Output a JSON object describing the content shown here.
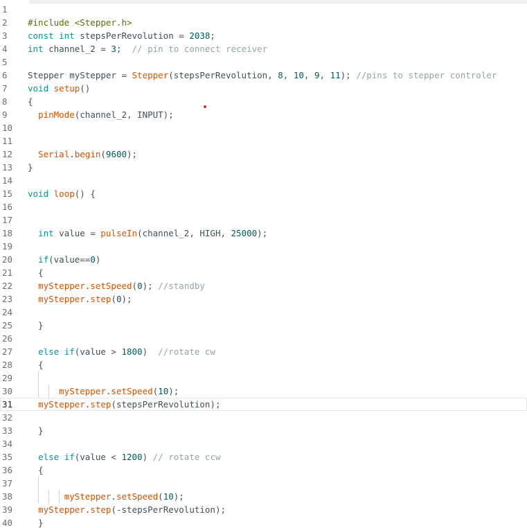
{
  "editor": {
    "current_line": 31,
    "lines": [
      {
        "n": "1",
        "tokens": []
      },
      {
        "n": "2",
        "tokens": [
          [
            "pp",
            "#include <Stepper.h>"
          ]
        ]
      },
      {
        "n": "3",
        "tokens": [
          [
            "kw",
            "const int"
          ],
          [
            "tx",
            " stepsPerRevolution = "
          ],
          [
            "num",
            "2038"
          ],
          [
            "tx",
            ";"
          ]
        ]
      },
      {
        "n": "4",
        "tokens": [
          [
            "kw",
            "int"
          ],
          [
            "tx",
            " channel_2 = "
          ],
          [
            "num",
            "3"
          ],
          [
            "tx",
            ";  "
          ],
          [
            "cm",
            "// pin to connect receiver"
          ]
        ]
      },
      {
        "n": "5",
        "tokens": []
      },
      {
        "n": "6",
        "tokens": [
          [
            "tx",
            "Stepper myStepper = "
          ],
          [
            "fn",
            "Stepper"
          ],
          [
            "tx",
            "(stepsPerRevolution, "
          ],
          [
            "num",
            "8"
          ],
          [
            "tx",
            ", "
          ],
          [
            "num",
            "10"
          ],
          [
            "tx",
            ", "
          ],
          [
            "num",
            "9"
          ],
          [
            "tx",
            ", "
          ],
          [
            "num",
            "11"
          ],
          [
            "tx",
            "); "
          ],
          [
            "cm",
            "//pins to stepper controler"
          ]
        ]
      },
      {
        "n": "7",
        "tokens": [
          [
            "kw",
            "void"
          ],
          [
            "tx",
            " "
          ],
          [
            "fn",
            "setup"
          ],
          [
            "tx",
            "()"
          ]
        ]
      },
      {
        "n": "8",
        "tokens": [
          [
            "tx",
            "{"
          ]
        ]
      },
      {
        "n": "9",
        "tokens": [
          [
            "tx",
            "  "
          ],
          [
            "fn",
            "pinMode"
          ],
          [
            "tx",
            "(channel_2, INPUT);"
          ]
        ]
      },
      {
        "n": "10",
        "tokens": []
      },
      {
        "n": "11",
        "tokens": []
      },
      {
        "n": "12",
        "tokens": [
          [
            "tx",
            "  "
          ],
          [
            "fn",
            "Serial"
          ],
          [
            "tx",
            "."
          ],
          [
            "fn",
            "begin"
          ],
          [
            "tx",
            "("
          ],
          [
            "num",
            "9600"
          ],
          [
            "tx",
            ");"
          ]
        ]
      },
      {
        "n": "13",
        "tokens": [
          [
            "tx",
            "}"
          ]
        ]
      },
      {
        "n": "14",
        "tokens": []
      },
      {
        "n": "15",
        "tokens": [
          [
            "kw",
            "void"
          ],
          [
            "tx",
            " "
          ],
          [
            "fn",
            "loop"
          ],
          [
            "tx",
            "() {"
          ]
        ]
      },
      {
        "n": "16",
        "tokens": []
      },
      {
        "n": "17",
        "tokens": []
      },
      {
        "n": "18",
        "tokens": [
          [
            "tx",
            "  "
          ],
          [
            "kw",
            "int"
          ],
          [
            "tx",
            " value = "
          ],
          [
            "fn",
            "pulseIn"
          ],
          [
            "tx",
            "(channel_2, HIGH, "
          ],
          [
            "num",
            "25000"
          ],
          [
            "tx",
            ");"
          ]
        ]
      },
      {
        "n": "19",
        "tokens": []
      },
      {
        "n": "20",
        "tokens": [
          [
            "tx",
            "  "
          ],
          [
            "kw",
            "if"
          ],
          [
            "tx",
            "(value=="
          ],
          [
            "num",
            "0"
          ],
          [
            "tx",
            ")"
          ]
        ]
      },
      {
        "n": "21",
        "tokens": [
          [
            "tx",
            "  {"
          ]
        ]
      },
      {
        "n": "22",
        "tokens": [
          [
            "tx",
            "  "
          ],
          [
            "fn",
            "myStepper"
          ],
          [
            "tx",
            "."
          ],
          [
            "fn",
            "setSpeed"
          ],
          [
            "tx",
            "("
          ],
          [
            "num",
            "0"
          ],
          [
            "tx",
            "); "
          ],
          [
            "cm",
            "//standby"
          ]
        ]
      },
      {
        "n": "23",
        "tokens": [
          [
            "tx",
            "  "
          ],
          [
            "fn",
            "myStepper"
          ],
          [
            "tx",
            "."
          ],
          [
            "fn",
            "step"
          ],
          [
            "tx",
            "("
          ],
          [
            "num",
            "0"
          ],
          [
            "tx",
            ");"
          ]
        ]
      },
      {
        "n": "24",
        "tokens": []
      },
      {
        "n": "25",
        "tokens": [
          [
            "tx",
            "  }"
          ]
        ]
      },
      {
        "n": "26",
        "tokens": []
      },
      {
        "n": "27",
        "tokens": [
          [
            "tx",
            "  "
          ],
          [
            "kw",
            "else if"
          ],
          [
            "tx",
            "(value > "
          ],
          [
            "num",
            "1800"
          ],
          [
            "tx",
            ")  "
          ],
          [
            "cm",
            "//rotate cw"
          ]
        ]
      },
      {
        "n": "28",
        "tokens": [
          [
            "tx",
            "  {"
          ]
        ]
      },
      {
        "n": "29",
        "tokens": []
      },
      {
        "n": "30",
        "tokens": [
          [
            "tx",
            "      "
          ],
          [
            "fn",
            "myStepper"
          ],
          [
            "tx",
            "."
          ],
          [
            "fn",
            "setSpeed"
          ],
          [
            "tx",
            "("
          ],
          [
            "num",
            "10"
          ],
          [
            "tx",
            ");"
          ]
        ]
      },
      {
        "n": "31",
        "tokens": [
          [
            "tx",
            "  "
          ],
          [
            "fn",
            "myStepper"
          ],
          [
            "tx",
            "."
          ],
          [
            "fn",
            "step"
          ],
          [
            "tx",
            "(stepsPerRevolution);"
          ]
        ]
      },
      {
        "n": "32",
        "tokens": []
      },
      {
        "n": "33",
        "tokens": [
          [
            "tx",
            "  }"
          ]
        ]
      },
      {
        "n": "34",
        "tokens": []
      },
      {
        "n": "35",
        "tokens": [
          [
            "tx",
            "  "
          ],
          [
            "kw",
            "else if"
          ],
          [
            "tx",
            "(value < "
          ],
          [
            "num",
            "1200"
          ],
          [
            "tx",
            ") "
          ],
          [
            "cm",
            "// rotate ccw"
          ]
        ]
      },
      {
        "n": "36",
        "tokens": [
          [
            "tx",
            "  {"
          ]
        ]
      },
      {
        "n": "37",
        "tokens": []
      },
      {
        "n": "38",
        "tokens": [
          [
            "tx",
            "       "
          ],
          [
            "fn",
            "myStepper"
          ],
          [
            "tx",
            "."
          ],
          [
            "fn",
            "setSpeed"
          ],
          [
            "tx",
            "("
          ],
          [
            "num",
            "10"
          ],
          [
            "tx",
            ");"
          ]
        ]
      },
      {
        "n": "39",
        "tokens": [
          [
            "tx",
            "  "
          ],
          [
            "fn",
            "myStepper"
          ],
          [
            "tx",
            "."
          ],
          [
            "fn",
            "step"
          ],
          [
            "tx",
            "(-stepsPerRevolution);"
          ]
        ]
      },
      {
        "n": "40",
        "tokens": [
          [
            "tx",
            "  }"
          ]
        ]
      }
    ]
  }
}
